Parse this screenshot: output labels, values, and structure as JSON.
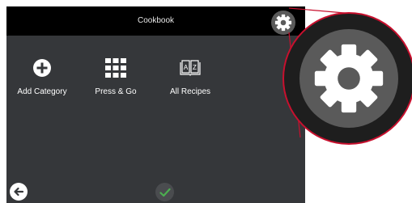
{
  "header": {
    "title": "Cookbook"
  },
  "tiles": [
    {
      "label": "Add Category",
      "icon": "plus-circle-icon"
    },
    {
      "label": "Press & Go",
      "icon": "grid-icon"
    },
    {
      "label": "All Recipes",
      "icon": "book-az-icon"
    }
  ],
  "footer": {
    "back_icon": "arrow-left-icon",
    "confirm_icon": "check-icon"
  },
  "icons": {
    "settings": "gear-icon",
    "zoom": "gear-icon"
  },
  "colors": {
    "screen_bg": "#35373a",
    "topbar_bg": "#000000",
    "accent_red": "#c8102e",
    "confirm_check": "#4caf50",
    "icon_bg": "#5a5a5a"
  }
}
